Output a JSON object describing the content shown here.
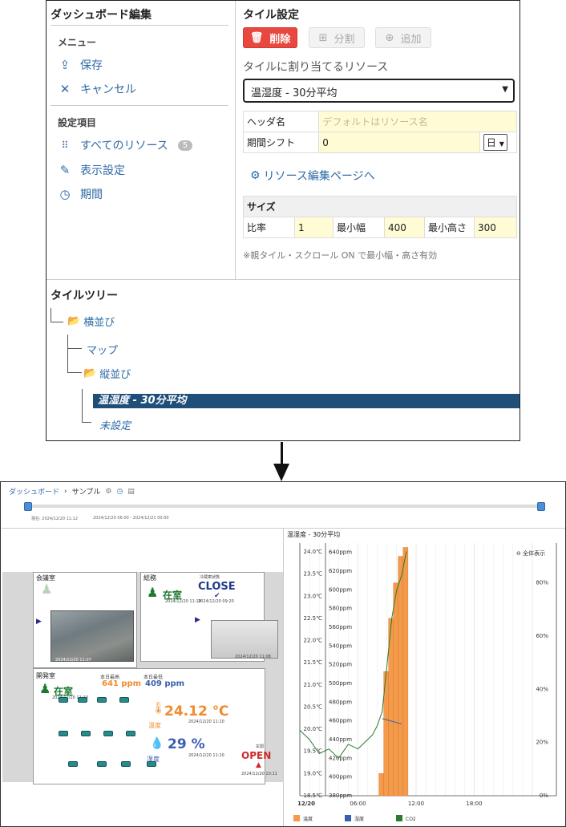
{
  "editor": {
    "left_title": "ダッシュボード編集",
    "menu_heading": "メニュー",
    "save": "保存",
    "cancel": "キャンセル",
    "settings_heading": "設定項目",
    "all_resources": "すべてのリソース",
    "all_resources_count": "5",
    "display_settings": "表示設定",
    "period": "期間",
    "right_title": "タイル設定",
    "delete_btn": "削除",
    "split_btn": "分割",
    "add_btn": "追加",
    "resource_label": "タイルに割り当てるリソース",
    "resource_value": "温湿度 - 30分平均",
    "header_name_label": "ヘッダ名",
    "header_name_placeholder": "デフォルトはリソース名",
    "period_shift_label": "期間シフト",
    "period_shift_value": "0",
    "period_shift_unit": "日",
    "resource_edit_link": "リソース編集ページへ",
    "size_heading": "サイズ",
    "ratio_label": "比率",
    "ratio_value": "1",
    "min_width_label": "最小幅",
    "min_width_value": "400",
    "min_height_label": "最小高さ",
    "min_height_value": "300",
    "note": "※親タイル・スクロール ON で最小幅・高さ有効"
  },
  "tree": {
    "title": "タイルツリー",
    "node_horizontal": "横並び",
    "node_map": "マップ",
    "node_vertical": "縦並び",
    "node_selected": "温湿度 - 30分平均",
    "node_unset": "未設定"
  },
  "dashboard": {
    "breadcrumb_root": "ダッシュボード",
    "breadcrumb_sep": "›",
    "breadcrumb_current": "サンプル",
    "now_label": "現在: 2024/12/20 11:12",
    "range1": "2024/12/20 06:00 - 2024/12/21 00:00",
    "map": {
      "room_meeting": "会議室",
      "room_general": "総務",
      "cooler_label": "冷蔵庫状態",
      "close": "CLOSE",
      "close_time": "2024/12/20 09:20",
      "zai1": "在室",
      "zai1_time": "2024/12/20 11:10",
      "cam_time1": "2024/12/20 11:07",
      "cam_time2": "2024/12/20 11:08",
      "room_dev": "開発室",
      "zai2": "在室",
      "zai2_time": "2024/12/20 11:10",
      "co2_label1": "本日最高",
      "co2_val1": "641 ppm",
      "co2_label2": "本日最低",
      "co2_val2": "409 ppm",
      "temp_val": "24.12 ℃",
      "temp_label": "温度",
      "temp_time": "2024/12/20 11:10",
      "hum_val": "29 %",
      "hum_label": "湿度",
      "hum_time": "2024/12/20 11:10",
      "door_label": "玄関",
      "open": "OPEN",
      "open_time": "2024/12/20 10:11"
    },
    "chart_title": "温湿度 - 30分平均",
    "zoom_label": "全体表示",
    "legend": [
      "温度",
      "湿度",
      "CO2"
    ]
  },
  "colors": {
    "primary": "#2d6aa6",
    "danger": "#e8483f",
    "selected": "#1f4e79",
    "temp": "#f39a4b",
    "humidity": "#3a5fae",
    "co2": "#2d7a2d"
  },
  "chart_data": {
    "type": "line",
    "x_ticks": [
      "12/20",
      "06:00",
      "12:00",
      "18:00"
    ],
    "y_left_temp": {
      "ticks": [
        "18.5℃",
        "19.0℃",
        "19.5℃",
        "20.0℃",
        "20.5℃",
        "21.0℃",
        "21.5℃",
        "22.0℃",
        "22.5℃",
        "23.0℃",
        "23.5℃",
        "24.0℃"
      ],
      "range": [
        18.5,
        24.2
      ]
    },
    "y_left_co2": {
      "ticks": [
        "380ppm",
        "400ppm",
        "420ppm",
        "440ppm",
        "460ppm",
        "480ppm",
        "500ppm",
        "520ppm",
        "540ppm",
        "560ppm",
        "580ppm",
        "600ppm",
        "620ppm",
        "640ppm"
      ],
      "range": [
        380,
        650
      ]
    },
    "y_right_hum": {
      "ticks": [
        "0%",
        "20%",
        "40%",
        "60%",
        "80%"
      ],
      "range": [
        0,
        95
      ]
    },
    "series": [
      {
        "name": "温度",
        "kind": "bar",
        "x_hours": [
          8.0,
          8.5,
          9.0,
          9.5,
          10.0,
          10.5
        ],
        "values": [
          19.0,
          21.3,
          22.5,
          23.3,
          23.9,
          24.1
        ]
      },
      {
        "name": "湿度",
        "kind": "line",
        "x_hours": [
          8.5,
          9.0,
          9.5,
          10.0,
          10.5
        ],
        "values": [
          29,
          28.5,
          28,
          27.5,
          27
        ]
      },
      {
        "name": "CO2",
        "kind": "line",
        "x_hours": [
          0,
          1,
          2,
          3,
          4,
          5,
          6,
          7,
          7.5,
          8,
          8.5,
          9,
          9.5,
          10,
          10.5,
          11
        ],
        "values": [
          450,
          440,
          425,
          430,
          420,
          435,
          430,
          440,
          445,
          455,
          470,
          520,
          570,
          600,
          615,
          641
        ]
      }
    ]
  }
}
